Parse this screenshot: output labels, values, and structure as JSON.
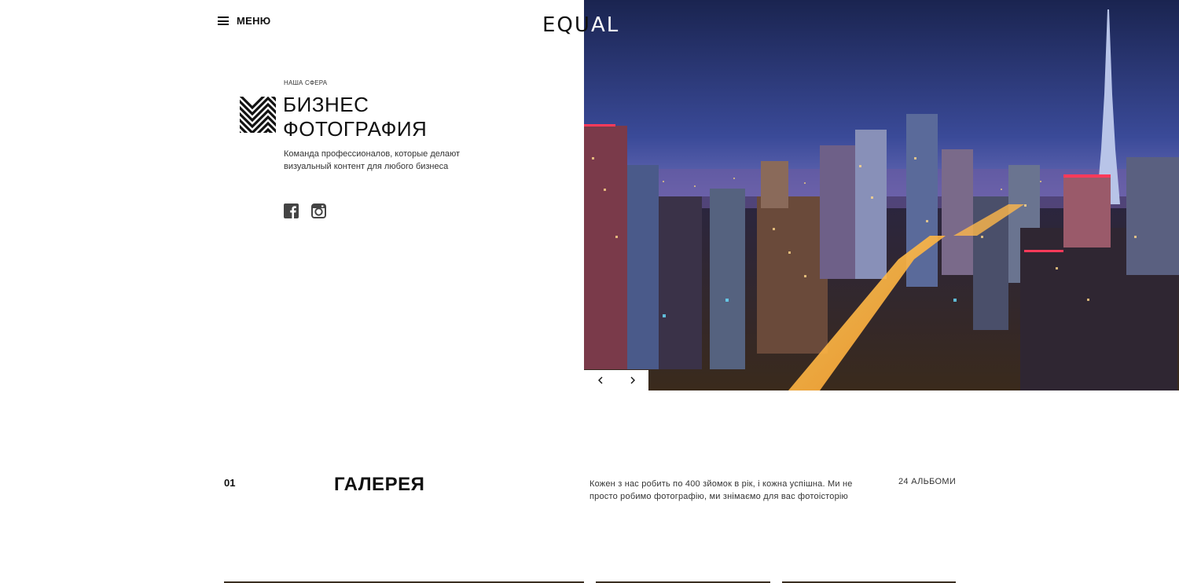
{
  "header": {
    "menu_label": "МЕНЮ",
    "logo_text_dark": "EQU",
    "logo_text_light": "AL"
  },
  "hero": {
    "eyebrow": "НАША СФЕРА",
    "title_line1": "БИЗНЕС",
    "title_line2": "ФОТОГРАФИЯ",
    "description": "Команда профессионалов, которые делают визуальный контент для любого бизнеса",
    "social": [
      "facebook-icon",
      "instagram-icon"
    ]
  },
  "slider": {
    "prev_icon": "chevron-left-icon",
    "next_icon": "chevron-right-icon"
  },
  "gallery": {
    "number": "01",
    "title": "ГАЛЕРЕЯ",
    "description": "Кожен з нас робить по 400 зйомок в рік, і кожна успішна. Ми не просто робимо фотографію, ми знімаємо для вас фотоісторію",
    "albums_count": "24 АЛЬБОМИ"
  },
  "colors": {
    "text": "#111111",
    "background": "#ffffff",
    "sky_top": "#1c2752",
    "sky_bottom": "#4a5aa8"
  }
}
